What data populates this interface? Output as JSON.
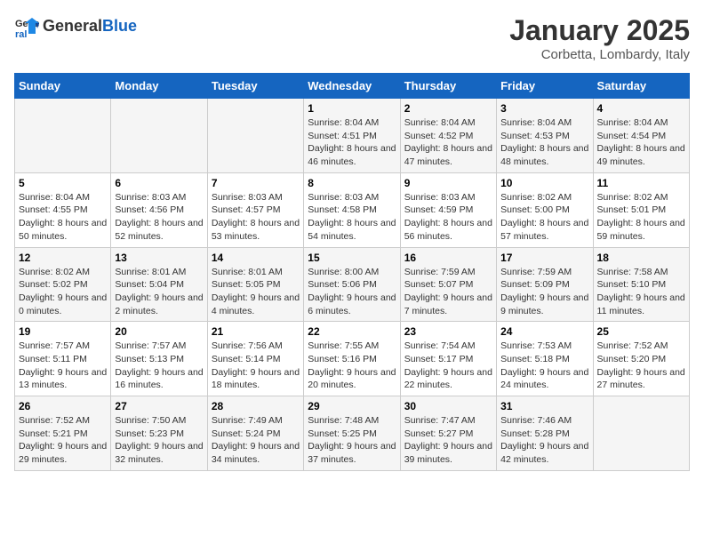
{
  "header": {
    "logo_general": "General",
    "logo_blue": "Blue",
    "month_title": "January 2025",
    "subtitle": "Corbetta, Lombardy, Italy"
  },
  "days_of_week": [
    "Sunday",
    "Monday",
    "Tuesday",
    "Wednesday",
    "Thursday",
    "Friday",
    "Saturday"
  ],
  "weeks": [
    [
      {
        "day": "",
        "info": ""
      },
      {
        "day": "",
        "info": ""
      },
      {
        "day": "",
        "info": ""
      },
      {
        "day": "1",
        "info": "Sunrise: 8:04 AM\nSunset: 4:51 PM\nDaylight: 8 hours\nand 46 minutes."
      },
      {
        "day": "2",
        "info": "Sunrise: 8:04 AM\nSunset: 4:52 PM\nDaylight: 8 hours\nand 47 minutes."
      },
      {
        "day": "3",
        "info": "Sunrise: 8:04 AM\nSunset: 4:53 PM\nDaylight: 8 hours\nand 48 minutes."
      },
      {
        "day": "4",
        "info": "Sunrise: 8:04 AM\nSunset: 4:54 PM\nDaylight: 8 hours\nand 49 minutes."
      }
    ],
    [
      {
        "day": "5",
        "info": "Sunrise: 8:04 AM\nSunset: 4:55 PM\nDaylight: 8 hours\nand 50 minutes."
      },
      {
        "day": "6",
        "info": "Sunrise: 8:03 AM\nSunset: 4:56 PM\nDaylight: 8 hours\nand 52 minutes."
      },
      {
        "day": "7",
        "info": "Sunrise: 8:03 AM\nSunset: 4:57 PM\nDaylight: 8 hours\nand 53 minutes."
      },
      {
        "day": "8",
        "info": "Sunrise: 8:03 AM\nSunset: 4:58 PM\nDaylight: 8 hours\nand 54 minutes."
      },
      {
        "day": "9",
        "info": "Sunrise: 8:03 AM\nSunset: 4:59 PM\nDaylight: 8 hours\nand 56 minutes."
      },
      {
        "day": "10",
        "info": "Sunrise: 8:02 AM\nSunset: 5:00 PM\nDaylight: 8 hours\nand 57 minutes."
      },
      {
        "day": "11",
        "info": "Sunrise: 8:02 AM\nSunset: 5:01 PM\nDaylight: 8 hours\nand 59 minutes."
      }
    ],
    [
      {
        "day": "12",
        "info": "Sunrise: 8:02 AM\nSunset: 5:02 PM\nDaylight: 9 hours\nand 0 minutes."
      },
      {
        "day": "13",
        "info": "Sunrise: 8:01 AM\nSunset: 5:04 PM\nDaylight: 9 hours\nand 2 minutes."
      },
      {
        "day": "14",
        "info": "Sunrise: 8:01 AM\nSunset: 5:05 PM\nDaylight: 9 hours\nand 4 minutes."
      },
      {
        "day": "15",
        "info": "Sunrise: 8:00 AM\nSunset: 5:06 PM\nDaylight: 9 hours\nand 6 minutes."
      },
      {
        "day": "16",
        "info": "Sunrise: 7:59 AM\nSunset: 5:07 PM\nDaylight: 9 hours\nand 7 minutes."
      },
      {
        "day": "17",
        "info": "Sunrise: 7:59 AM\nSunset: 5:09 PM\nDaylight: 9 hours\nand 9 minutes."
      },
      {
        "day": "18",
        "info": "Sunrise: 7:58 AM\nSunset: 5:10 PM\nDaylight: 9 hours\nand 11 minutes."
      }
    ],
    [
      {
        "day": "19",
        "info": "Sunrise: 7:57 AM\nSunset: 5:11 PM\nDaylight: 9 hours\nand 13 minutes."
      },
      {
        "day": "20",
        "info": "Sunrise: 7:57 AM\nSunset: 5:13 PM\nDaylight: 9 hours\nand 16 minutes."
      },
      {
        "day": "21",
        "info": "Sunrise: 7:56 AM\nSunset: 5:14 PM\nDaylight: 9 hours\nand 18 minutes."
      },
      {
        "day": "22",
        "info": "Sunrise: 7:55 AM\nSunset: 5:16 PM\nDaylight: 9 hours\nand 20 minutes."
      },
      {
        "day": "23",
        "info": "Sunrise: 7:54 AM\nSunset: 5:17 PM\nDaylight: 9 hours\nand 22 minutes."
      },
      {
        "day": "24",
        "info": "Sunrise: 7:53 AM\nSunset: 5:18 PM\nDaylight: 9 hours\nand 24 minutes."
      },
      {
        "day": "25",
        "info": "Sunrise: 7:52 AM\nSunset: 5:20 PM\nDaylight: 9 hours\nand 27 minutes."
      }
    ],
    [
      {
        "day": "26",
        "info": "Sunrise: 7:52 AM\nSunset: 5:21 PM\nDaylight: 9 hours\nand 29 minutes."
      },
      {
        "day": "27",
        "info": "Sunrise: 7:50 AM\nSunset: 5:23 PM\nDaylight: 9 hours\nand 32 minutes."
      },
      {
        "day": "28",
        "info": "Sunrise: 7:49 AM\nSunset: 5:24 PM\nDaylight: 9 hours\nand 34 minutes."
      },
      {
        "day": "29",
        "info": "Sunrise: 7:48 AM\nSunset: 5:25 PM\nDaylight: 9 hours\nand 37 minutes."
      },
      {
        "day": "30",
        "info": "Sunrise: 7:47 AM\nSunset: 5:27 PM\nDaylight: 9 hours\nand 39 minutes."
      },
      {
        "day": "31",
        "info": "Sunrise: 7:46 AM\nSunset: 5:28 PM\nDaylight: 9 hours\nand 42 minutes."
      },
      {
        "day": "",
        "info": ""
      }
    ]
  ]
}
